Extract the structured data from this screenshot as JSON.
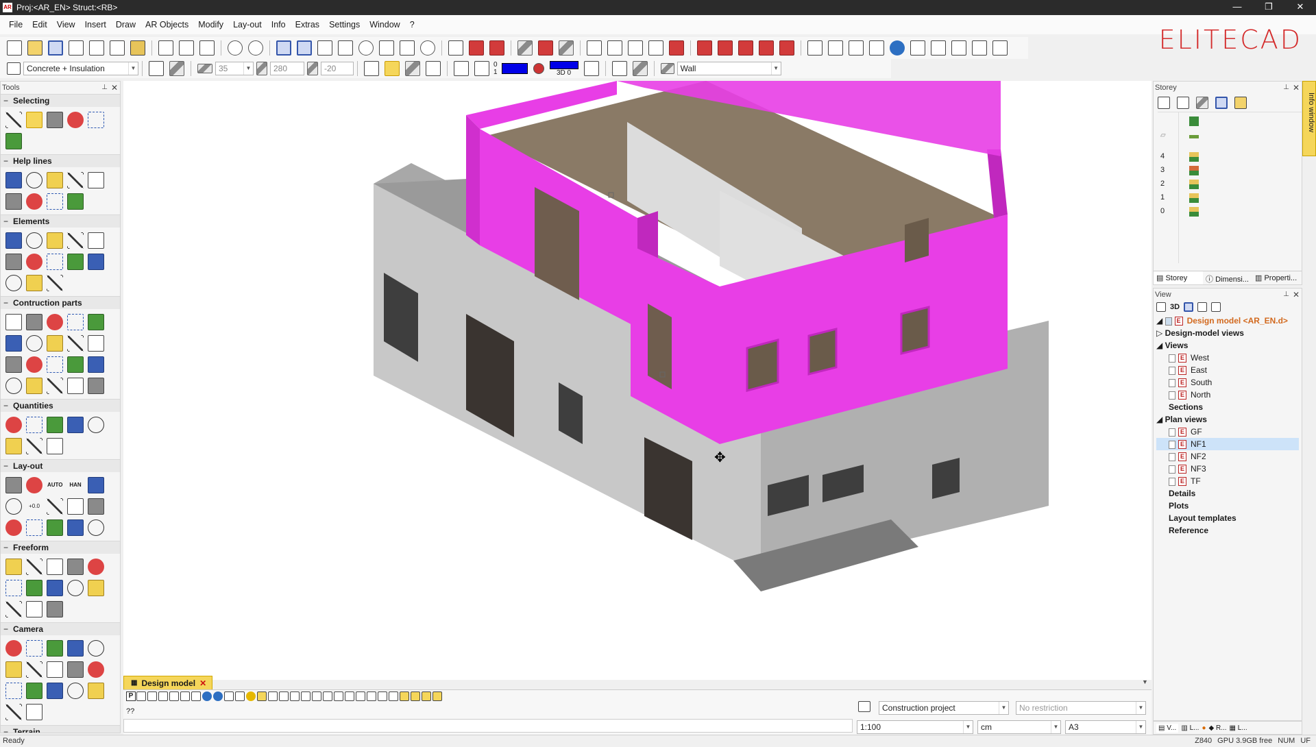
{
  "titlebar": {
    "title": "Proj:<AR_EN> Struct:<RB>",
    "app_icon": "AR",
    "min": "—",
    "max": "❐",
    "close": "✕"
  },
  "menu": [
    "File",
    "Edit",
    "View",
    "Insert",
    "Draw",
    "AR Objects",
    "Modify",
    "Lay-out",
    "Info",
    "Extras",
    "Settings",
    "Window",
    "?"
  ],
  "logo": "ELITECAD",
  "props": {
    "material": "Concrete + Insulation",
    "thickness": "35",
    "height": "280",
    "offset": "-20",
    "pen_top": "0",
    "pen_bottom": "1",
    "view_label": "3D 0",
    "component": "Wall"
  },
  "tools_panel": {
    "title": "Tools",
    "sections": [
      {
        "name": "Selecting",
        "rows": [
          5,
          1
        ]
      },
      {
        "name": "Help lines",
        "rows": [
          5,
          4
        ]
      },
      {
        "name": "Elements",
        "rows": [
          5,
          5,
          3
        ]
      },
      {
        "name": "Contruction parts",
        "rows": [
          5,
          5,
          5,
          5
        ]
      },
      {
        "name": "Quantities",
        "rows": [
          5,
          3
        ]
      },
      {
        "name": "Lay-out",
        "rows": [
          5,
          5,
          5
        ]
      },
      {
        "name": "Freeform",
        "rows": [
          5,
          5,
          3
        ]
      },
      {
        "name": "Camera",
        "rows": [
          5,
          5,
          5,
          2
        ]
      },
      {
        "name": "Terrain",
        "rows": []
      }
    ],
    "layout_texts": {
      "auto": "AUTO",
      "han": "HAN",
      "dim": "+0.0"
    }
  },
  "storey_panel": {
    "title": "Storey",
    "levels": [
      "4",
      "3",
      "2",
      "1",
      "0"
    ],
    "tabs": [
      "Storey",
      "Dimensi...",
      "Properti..."
    ]
  },
  "view_panel": {
    "title": "View",
    "toolbar_3d": "3D",
    "root": "Design model <AR_EN.d>",
    "dm_views": "Design-model views",
    "views": "Views",
    "view_items": [
      "West",
      "East",
      "South",
      "North"
    ],
    "sections": "Sections",
    "plan_views": "Plan views",
    "plan_items": [
      "GF",
      "NF1",
      "NF2",
      "NF3",
      "TF"
    ],
    "selected_plan": "NF1",
    "details": "Details",
    "plots": "Plots",
    "layout_templates": "Layout templates",
    "reference": "Reference"
  },
  "info_window": "Info window",
  "bottom": {
    "tab": "Design model",
    "cmd_prompt": "??",
    "project_type": "Construction project",
    "restriction": "No restriction",
    "scale": "1:100",
    "unit": "cm",
    "paper": "A3",
    "right_tabs": [
      "V...",
      "L...",
      "",
      "R...",
      "L..."
    ]
  },
  "status": {
    "left": "Ready",
    "z": "Z840",
    "gpu": "GPU 3.9GB free",
    "num": "NUM",
    "uf": "UF"
  },
  "colors": {
    "highlight": "#e83ee6",
    "accent": "#d42b2b",
    "selection": "#cde3f9"
  }
}
